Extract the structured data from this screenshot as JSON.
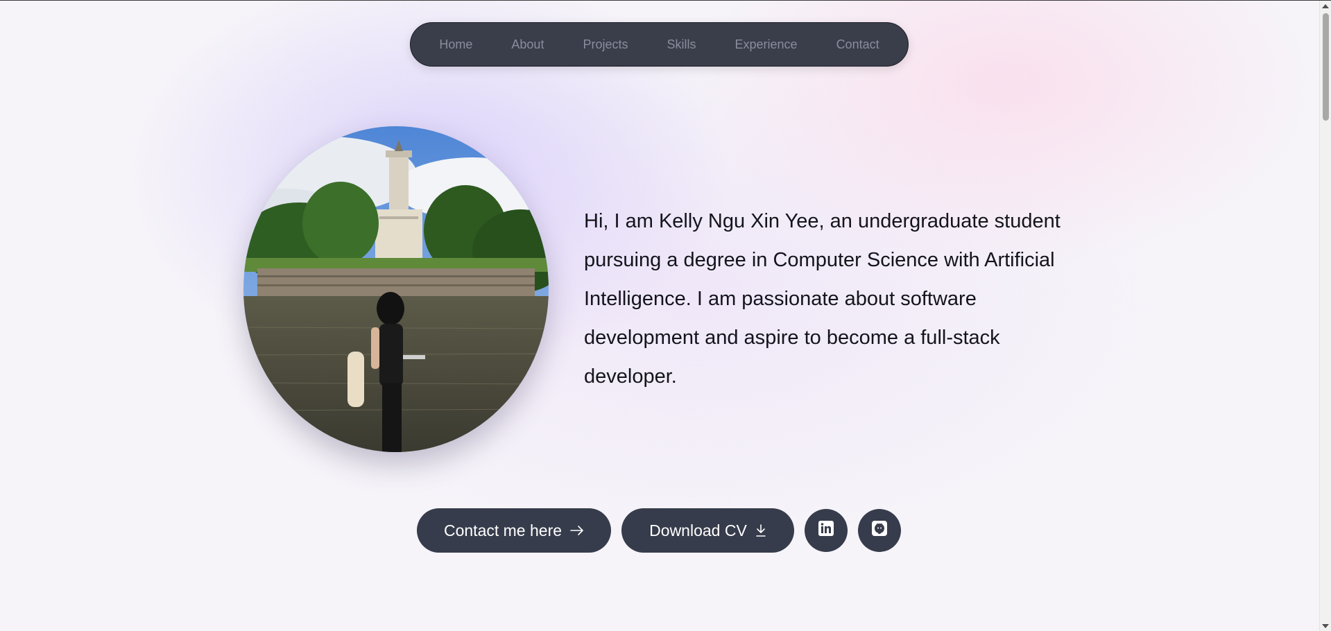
{
  "nav": {
    "items": [
      {
        "label": "Home"
      },
      {
        "label": "About"
      },
      {
        "label": "Projects"
      },
      {
        "label": "Skills"
      },
      {
        "label": "Experience"
      },
      {
        "label": "Contact"
      }
    ]
  },
  "hero": {
    "intro": "Hi, I am Kelly Ngu Xin Yee, an undergraduate student pursuing a degree in Computer Science with Artificial Intelligence. I am passionate about software development and aspire to become a full-stack developer."
  },
  "actions": {
    "contact_label": "Contact me here",
    "contact_icon": "arrow-right-icon",
    "cv_label": "Download CV",
    "cv_icon": "download-icon",
    "linkedin_icon": "linkedin-icon",
    "github_icon": "github-icon"
  },
  "colors": {
    "nav_bg": "#3a3d4a",
    "button_bg": "#363c4b",
    "text": "#14141c"
  }
}
